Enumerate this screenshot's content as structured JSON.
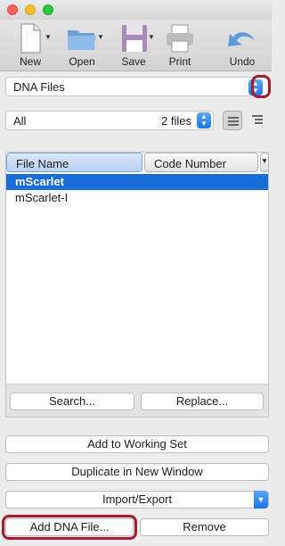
{
  "toolbar": {
    "new_label": "New",
    "open_label": "Open",
    "save_label": "Save",
    "print_label": "Print",
    "undo_label": "Undo"
  },
  "collection": {
    "value": "DNA Files"
  },
  "filter": {
    "value": "All",
    "count": "2 files"
  },
  "table": {
    "headers": [
      "File Name",
      "Code Number"
    ],
    "rows": [
      "mScarlet",
      "mScarlet-I"
    ]
  },
  "actions": {
    "search_label": "Search...",
    "replace_label": "Replace...",
    "add_working_set_label": "Add to Working Set",
    "duplicate_label": "Duplicate in New Window",
    "import_export_label": "Import/Export",
    "add_dna_label": "Add DNA File...",
    "remove_label": "Remove"
  },
  "colors": {
    "accent": "#1a6cd8",
    "highlight": "#a61c2c"
  }
}
